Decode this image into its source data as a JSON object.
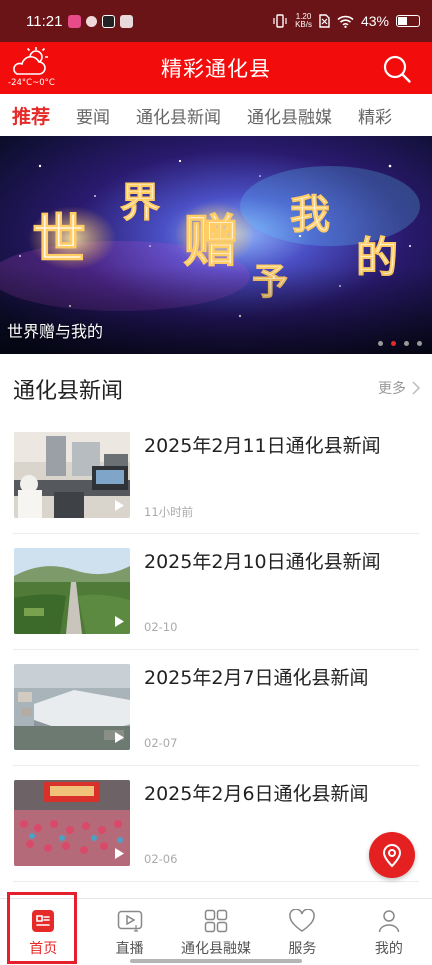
{
  "status_bar": {
    "time": "11:21",
    "net_speed_top": "1.20",
    "net_speed_bottom": "KB/s",
    "battery": "43%"
  },
  "header": {
    "title": "精彩通化县",
    "weather_temp": "-24°C~0°C"
  },
  "tabs": [
    {
      "label": "推荐",
      "active": true
    },
    {
      "label": "要闻",
      "active": false
    },
    {
      "label": "通化县新闻",
      "active": false
    },
    {
      "label": "通化县融媒",
      "active": false
    },
    {
      "label": "精彩",
      "active": false
    }
  ],
  "banner": {
    "caption": "世界赠与我的",
    "art_text": [
      "世",
      "界",
      "赠",
      "予",
      "我",
      "的"
    ],
    "slide_count": 4,
    "active_slide": 2
  },
  "section": {
    "title": "通化县新闻",
    "more_label": "更多"
  },
  "news": [
    {
      "title": "2025年2月11日通化县新闻",
      "time": "11小时前"
    },
    {
      "title": "2025年2月10日通化县新闻",
      "time": "02-10"
    },
    {
      "title": "2025年2月7日通化县新闻",
      "time": "02-07"
    },
    {
      "title": "2025年2月6日通化县新闻",
      "time": "02-06"
    }
  ],
  "bottom_nav": [
    {
      "label": "首页",
      "icon": "home-news-icon",
      "active": true
    },
    {
      "label": "直播",
      "icon": "live-video-icon",
      "active": false
    },
    {
      "label": "通化县融媒",
      "icon": "grid-apps-icon",
      "active": false
    },
    {
      "label": "服务",
      "icon": "heart-service-icon",
      "active": false
    },
    {
      "label": "我的",
      "icon": "user-profile-icon",
      "active": false
    }
  ],
  "colors": {
    "header_red": "#f30c0c",
    "accent_red": "#e52a28",
    "status_bar": "#6a1417"
  }
}
